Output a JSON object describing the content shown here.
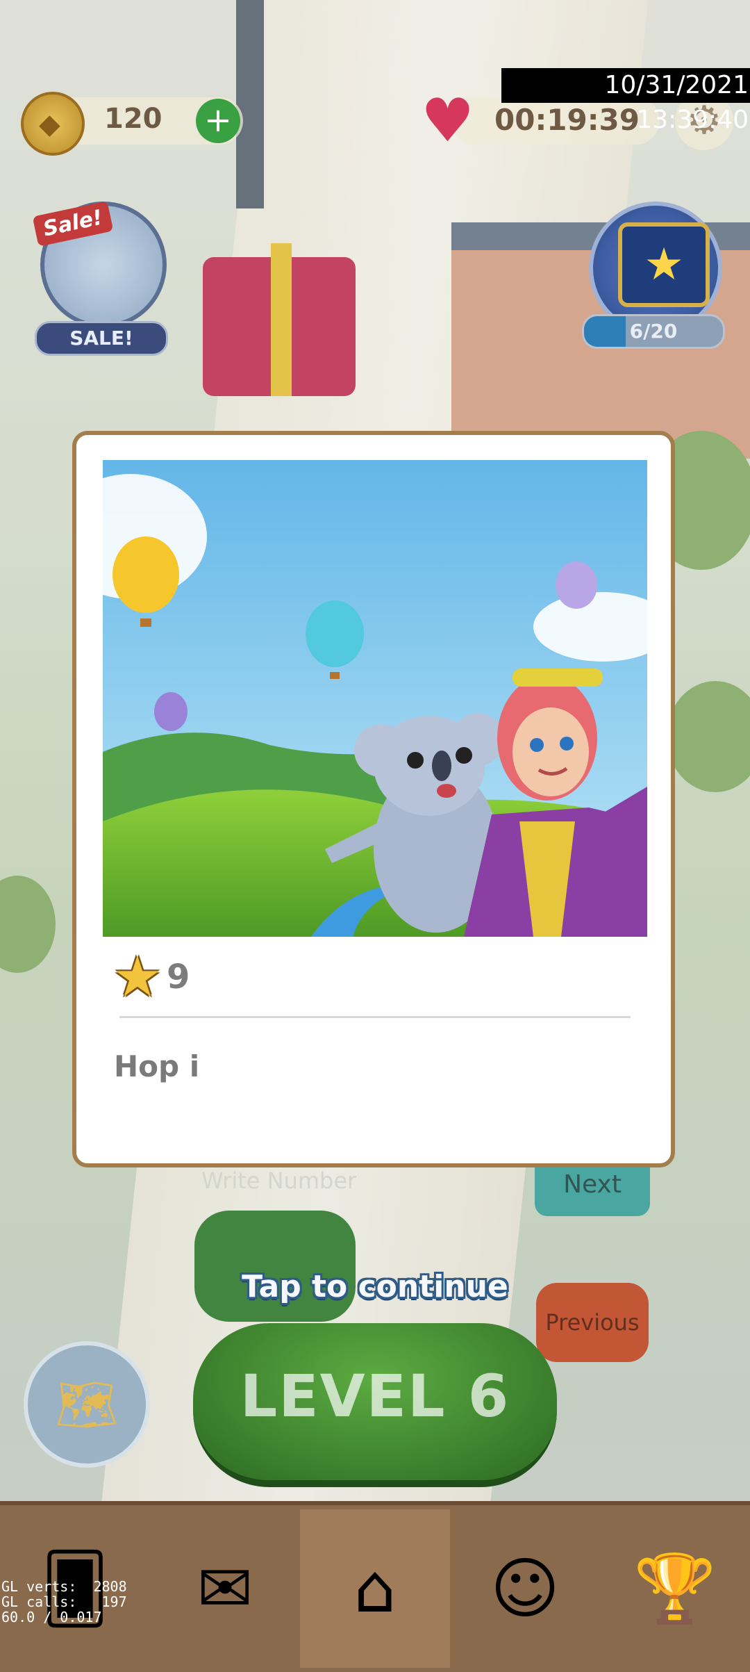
{
  "hud": {
    "coins": "120",
    "coin_add_icon": "plus-icon",
    "lives_timer": "00:19:39",
    "lives_icon": "infinity-heart-icon",
    "settings_icon": "gear-icon",
    "datetime_overlay": "10/31/2021 13:39:40"
  },
  "sale": {
    "flag_label": "Sale!",
    "button_label": "SALE!"
  },
  "star_chest": {
    "progress_label": "6/20",
    "progress_fraction": 0.3
  },
  "background_controls": {
    "write_number_placeholder": "Write Number",
    "next_label": "Next",
    "previous_label": "Previous",
    "level_label": "LEVEL 6"
  },
  "modal": {
    "reward_stars": "9",
    "story_text": "Hop i",
    "tap_to_continue": "Tap to continue"
  },
  "nav": {
    "items": [
      {
        "icon": "cards-icon"
      },
      {
        "icon": "mail-heart-icon"
      },
      {
        "icon": "home-icon"
      },
      {
        "icon": "team-icon"
      },
      {
        "icon": "trophy-icon"
      }
    ]
  },
  "debug": {
    "line1": "GL verts:  2808",
    "line2": "GL calls:   197",
    "line3": "60.0 / 0.017"
  },
  "colors": {
    "modal_border": "#a47d4d",
    "level_button": "#3b8a30",
    "tap_text_outline": "#2f5c86"
  }
}
